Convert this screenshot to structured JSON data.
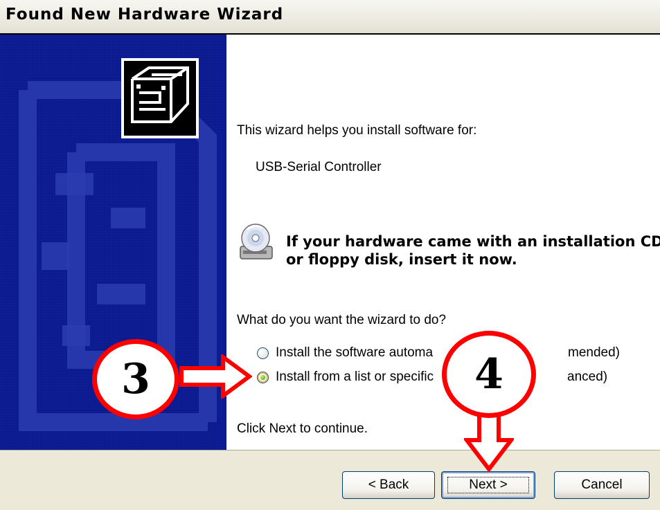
{
  "window": {
    "title": "Found New Hardware Wizard"
  },
  "content": {
    "intro": "This wizard helps you install software for:",
    "device_name": "USB-Serial Controller",
    "cd_note_line1": "If your hardware came with an installation CD",
    "cd_note_line2": "or floppy disk, insert it now.",
    "question": "What do you want the wizard to do?",
    "options": [
      {
        "label": "Install the software automa",
        "label_tail": "mended)",
        "selected": false
      },
      {
        "label": "Install from a list or specific",
        "label_tail": "anced)",
        "selected": true
      }
    ],
    "continue_hint": "Click Next to continue."
  },
  "buttons": {
    "back": "< Back",
    "next": "Next >",
    "cancel": "Cancel"
  },
  "annotations": {
    "step_3": "3",
    "step_4": "4",
    "color": "#ff0000"
  },
  "icons": {
    "hardware": "hardware-box-icon",
    "cd": "cd-drive-icon"
  }
}
